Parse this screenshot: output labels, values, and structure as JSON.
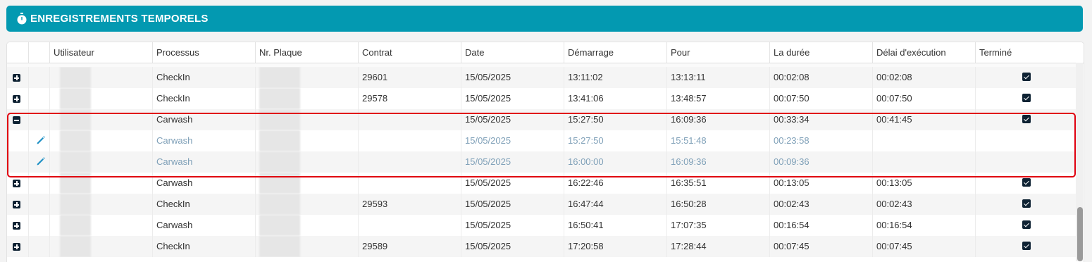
{
  "panel": {
    "title": "ENREGISTREMENTS TEMPORELS",
    "icon": "stopwatch-icon",
    "accent": "#0399b1"
  },
  "columns": [
    "Utilisateur",
    "Processus",
    "Nr. Plaque",
    "Contrat",
    "Date",
    "Démarrage",
    "Pour",
    "La durée",
    "Délai d'exécution",
    "Terminé"
  ],
  "rows": [
    {
      "kind": "parent",
      "expander": "plus",
      "processus": "CheckIn",
      "contrat": "29601",
      "date": "15/05/2025",
      "demarrage": "13:11:02",
      "pour": "13:13:11",
      "duree": "00:02:08",
      "delai": "00:02:08",
      "termine": true
    },
    {
      "kind": "parent",
      "expander": "plus",
      "processus": "CheckIn",
      "contrat": "29578",
      "date": "15/05/2025",
      "demarrage": "13:41:06",
      "pour": "13:48:57",
      "duree": "00:07:50",
      "delai": "00:07:50",
      "termine": true
    },
    {
      "kind": "parent",
      "expander": "minus",
      "processus": "Carwash",
      "contrat": "",
      "date": "15/05/2025",
      "demarrage": "15:27:50",
      "pour": "16:09:36",
      "duree": "00:33:34",
      "delai": "00:41:45",
      "termine": true
    },
    {
      "kind": "sub",
      "processus": "Carwash",
      "contrat": "",
      "date": "15/05/2025",
      "demarrage": "15:27:50",
      "pour": "15:51:48",
      "duree": "00:23:58",
      "delai": "",
      "termine": false
    },
    {
      "kind": "sub",
      "processus": "Carwash",
      "contrat": "",
      "date": "15/05/2025",
      "demarrage": "16:00:00",
      "pour": "16:09:36",
      "duree": "00:09:36",
      "delai": "",
      "termine": false
    },
    {
      "kind": "parent",
      "expander": "plus",
      "processus": "Carwash",
      "contrat": "",
      "date": "15/05/2025",
      "demarrage": "16:22:46",
      "pour": "16:35:51",
      "duree": "00:13:05",
      "delai": "00:13:05",
      "termine": true
    },
    {
      "kind": "parent",
      "expander": "plus",
      "processus": "CheckIn",
      "contrat": "29593",
      "date": "15/05/2025",
      "demarrage": "16:47:44",
      "pour": "16:50:28",
      "duree": "00:02:43",
      "delai": "00:02:43",
      "termine": true
    },
    {
      "kind": "parent",
      "expander": "plus",
      "processus": "Carwash",
      "contrat": "",
      "date": "15/05/2025",
      "demarrage": "16:50:41",
      "pour": "17:07:35",
      "duree": "00:16:54",
      "delai": "00:16:54",
      "termine": true
    },
    {
      "kind": "parent",
      "expander": "plus",
      "processus": "CheckIn",
      "contrat": "29589",
      "date": "15/05/2025",
      "demarrage": "17:20:58",
      "pour": "17:28:44",
      "duree": "00:07:45",
      "delai": "00:07:45",
      "termine": true
    }
  ],
  "colors": {
    "highlight": "#e0000f",
    "sub_text": "#7fa0b8",
    "checkbox": "#0e2233"
  }
}
